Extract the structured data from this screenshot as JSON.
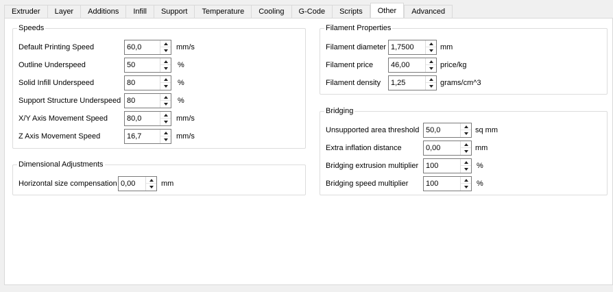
{
  "tabs": [
    {
      "label": "Extruder"
    },
    {
      "label": "Layer"
    },
    {
      "label": "Additions"
    },
    {
      "label": "Infill"
    },
    {
      "label": "Support"
    },
    {
      "label": "Temperature"
    },
    {
      "label": "Cooling"
    },
    {
      "label": "G-Code"
    },
    {
      "label": "Scripts"
    },
    {
      "label": "Other",
      "active": true
    },
    {
      "label": "Advanced"
    }
  ],
  "speeds": {
    "title": "Speeds",
    "rows": [
      {
        "label": "Default Printing Speed",
        "value": "60,0",
        "unit": "mm/s"
      },
      {
        "label": "Outline Underspeed",
        "value": "50",
        "unit": "%"
      },
      {
        "label": "Solid Infill Underspeed",
        "value": "80",
        "unit": "%"
      },
      {
        "label": "Support Structure Underspeed",
        "value": "80",
        "unit": "%"
      },
      {
        "label": "X/Y Axis Movement Speed",
        "value": "80,0",
        "unit": "mm/s"
      },
      {
        "label": "Z Axis Movement Speed",
        "value": "16,7",
        "unit": "mm/s"
      }
    ]
  },
  "dimensional": {
    "title": "Dimensional Adjustments",
    "rows": [
      {
        "label": "Horizontal size compensation",
        "value": "0,00",
        "unit": "mm"
      }
    ]
  },
  "filament": {
    "title": "Filament Properties",
    "rows": [
      {
        "label": "Filament diameter",
        "value": "1,7500",
        "unit": "mm"
      },
      {
        "label": "Filament price",
        "value": "46,00",
        "unit": "price/kg"
      },
      {
        "label": "Filament density",
        "value": "1,25",
        "unit": "grams/cm^3"
      }
    ]
  },
  "bridging": {
    "title": "Bridging",
    "rows": [
      {
        "label": "Unsupported area threshold",
        "value": "50,0",
        "unit": "sq mm"
      },
      {
        "label": "Extra inflation distance",
        "value": "0,00",
        "unit": "mm"
      },
      {
        "label": "Bridging extrusion multiplier",
        "value": "100",
        "unit": "%"
      },
      {
        "label": "Bridging speed multiplier",
        "value": "100",
        "unit": "%"
      }
    ]
  }
}
